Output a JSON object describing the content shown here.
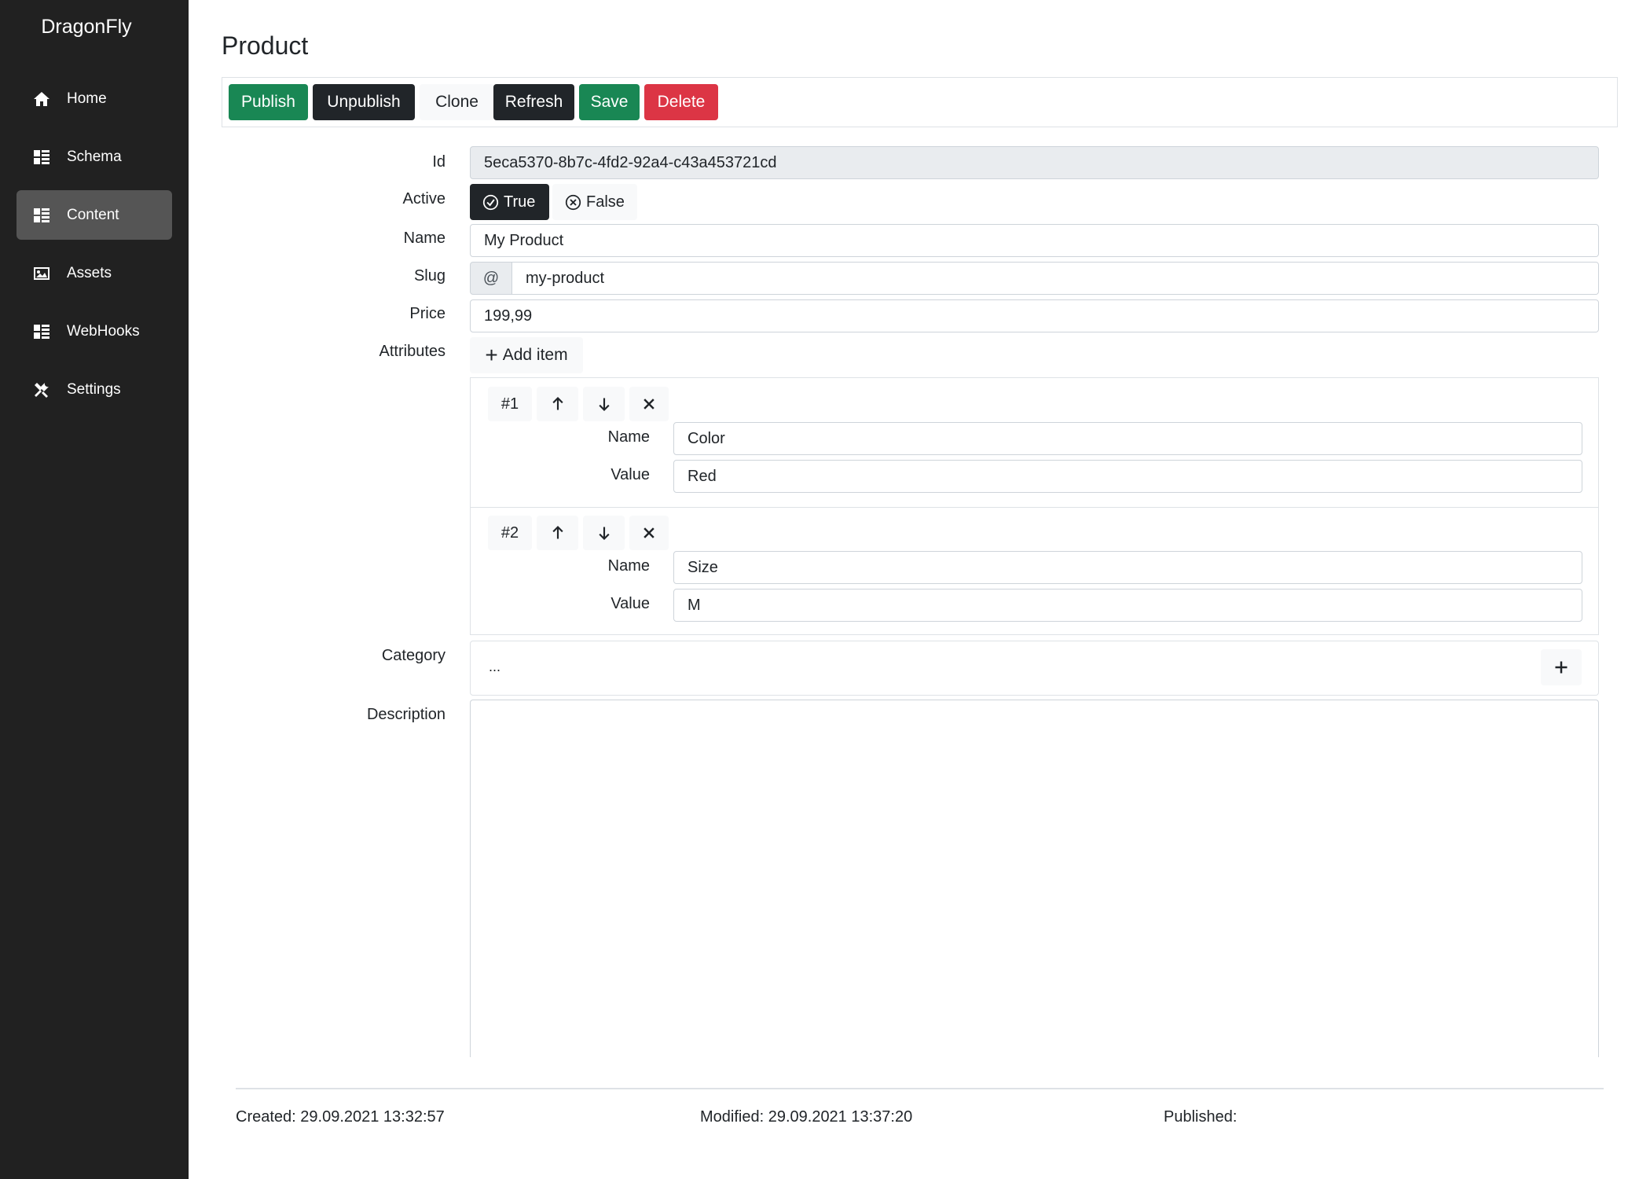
{
  "app": {
    "brand": "DragonFly"
  },
  "sidebar": {
    "items": [
      {
        "label": "Home",
        "icon": "home-icon"
      },
      {
        "label": "Schema",
        "icon": "list-icon"
      },
      {
        "label": "Content",
        "icon": "list-icon",
        "active": true
      },
      {
        "label": "Assets",
        "icon": "image-icon"
      },
      {
        "label": "WebHooks",
        "icon": "list-icon"
      },
      {
        "label": "Settings",
        "icon": "tools-icon"
      }
    ]
  },
  "page": {
    "title": "Product"
  },
  "toolbar": {
    "publish": "Publish",
    "unpublish": "Unpublish",
    "clone": "Clone",
    "refresh": "Refresh",
    "save": "Save",
    "delete": "Delete"
  },
  "form": {
    "id": {
      "label": "Id",
      "value": "5eca5370-8b7c-4fd2-92a4-c43a453721cd"
    },
    "active": {
      "label": "Active",
      "true_label": "True",
      "false_label": "False",
      "value": "True"
    },
    "name": {
      "label": "Name",
      "value": "My Product"
    },
    "slug": {
      "label": "Slug",
      "prefix": "@",
      "value": "my-product"
    },
    "price": {
      "label": "Price",
      "value": "199,99"
    },
    "attributes": {
      "label": "Attributes",
      "add_label": "Add item",
      "items": [
        {
          "index": "#1",
          "name_label": "Name",
          "value_label": "Value",
          "name": "Color",
          "value": "Red"
        },
        {
          "index": "#2",
          "name_label": "Name",
          "value_label": "Value",
          "name": "Size",
          "value": "M"
        }
      ]
    },
    "category": {
      "label": "Category",
      "value": "..."
    },
    "description": {
      "label": "Description",
      "value": ""
    }
  },
  "footer": {
    "created": "Created: 29.09.2021 13:32:57",
    "modified": "Modified: 29.09.2021 13:37:20",
    "published": "Published:"
  },
  "colors": {
    "sidebar_bg": "#212121",
    "active_nav": "#555555",
    "success": "#198754",
    "dark": "#212529",
    "danger": "#dc3545"
  }
}
